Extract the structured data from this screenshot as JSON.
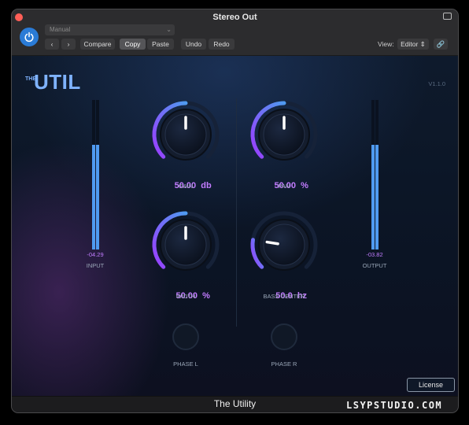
{
  "window": {
    "title": "Stereo Out"
  },
  "toolbar": {
    "preset": "Manual",
    "compare": "Compare",
    "copy": "Copy",
    "paste": "Paste",
    "undo": "Undo",
    "redo": "Redo",
    "view_label": "View:",
    "view_value": "Editor"
  },
  "plugin": {
    "logo_the": "THE",
    "logo_name": "UTIL",
    "version": "V1.1.0",
    "input": {
      "value": "-04.29",
      "label": "INPUT",
      "level": 0.7
    },
    "output": {
      "value": "-03.82",
      "label": "OUTPUT",
      "level": 0.7
    },
    "knobs": {
      "gain": {
        "value": "50.00",
        "unit": "db",
        "label": "GAIN",
        "position": 0.5
      },
      "pan": {
        "value": "50.00",
        "unit": "%",
        "label": "PAN",
        "position": 0.5
      },
      "width": {
        "value": "50.00",
        "unit": "%",
        "label": "WIDTH",
        "position": 0.5
      },
      "bass_center": {
        "value": "50.0",
        "unit": "hz",
        "label": "BASS CENTER",
        "position": 0.2
      }
    },
    "phase_l": "PHASE  L",
    "phase_r": "PHASE  R",
    "license": "License"
  },
  "footer": {
    "title": "The Utility"
  },
  "watermark": "LSYPSTUDIO.COM",
  "colors": {
    "accent_purple": "#c27cff",
    "accent_blue": "#4f9af0",
    "power_blue": "#2a7bd6"
  }
}
